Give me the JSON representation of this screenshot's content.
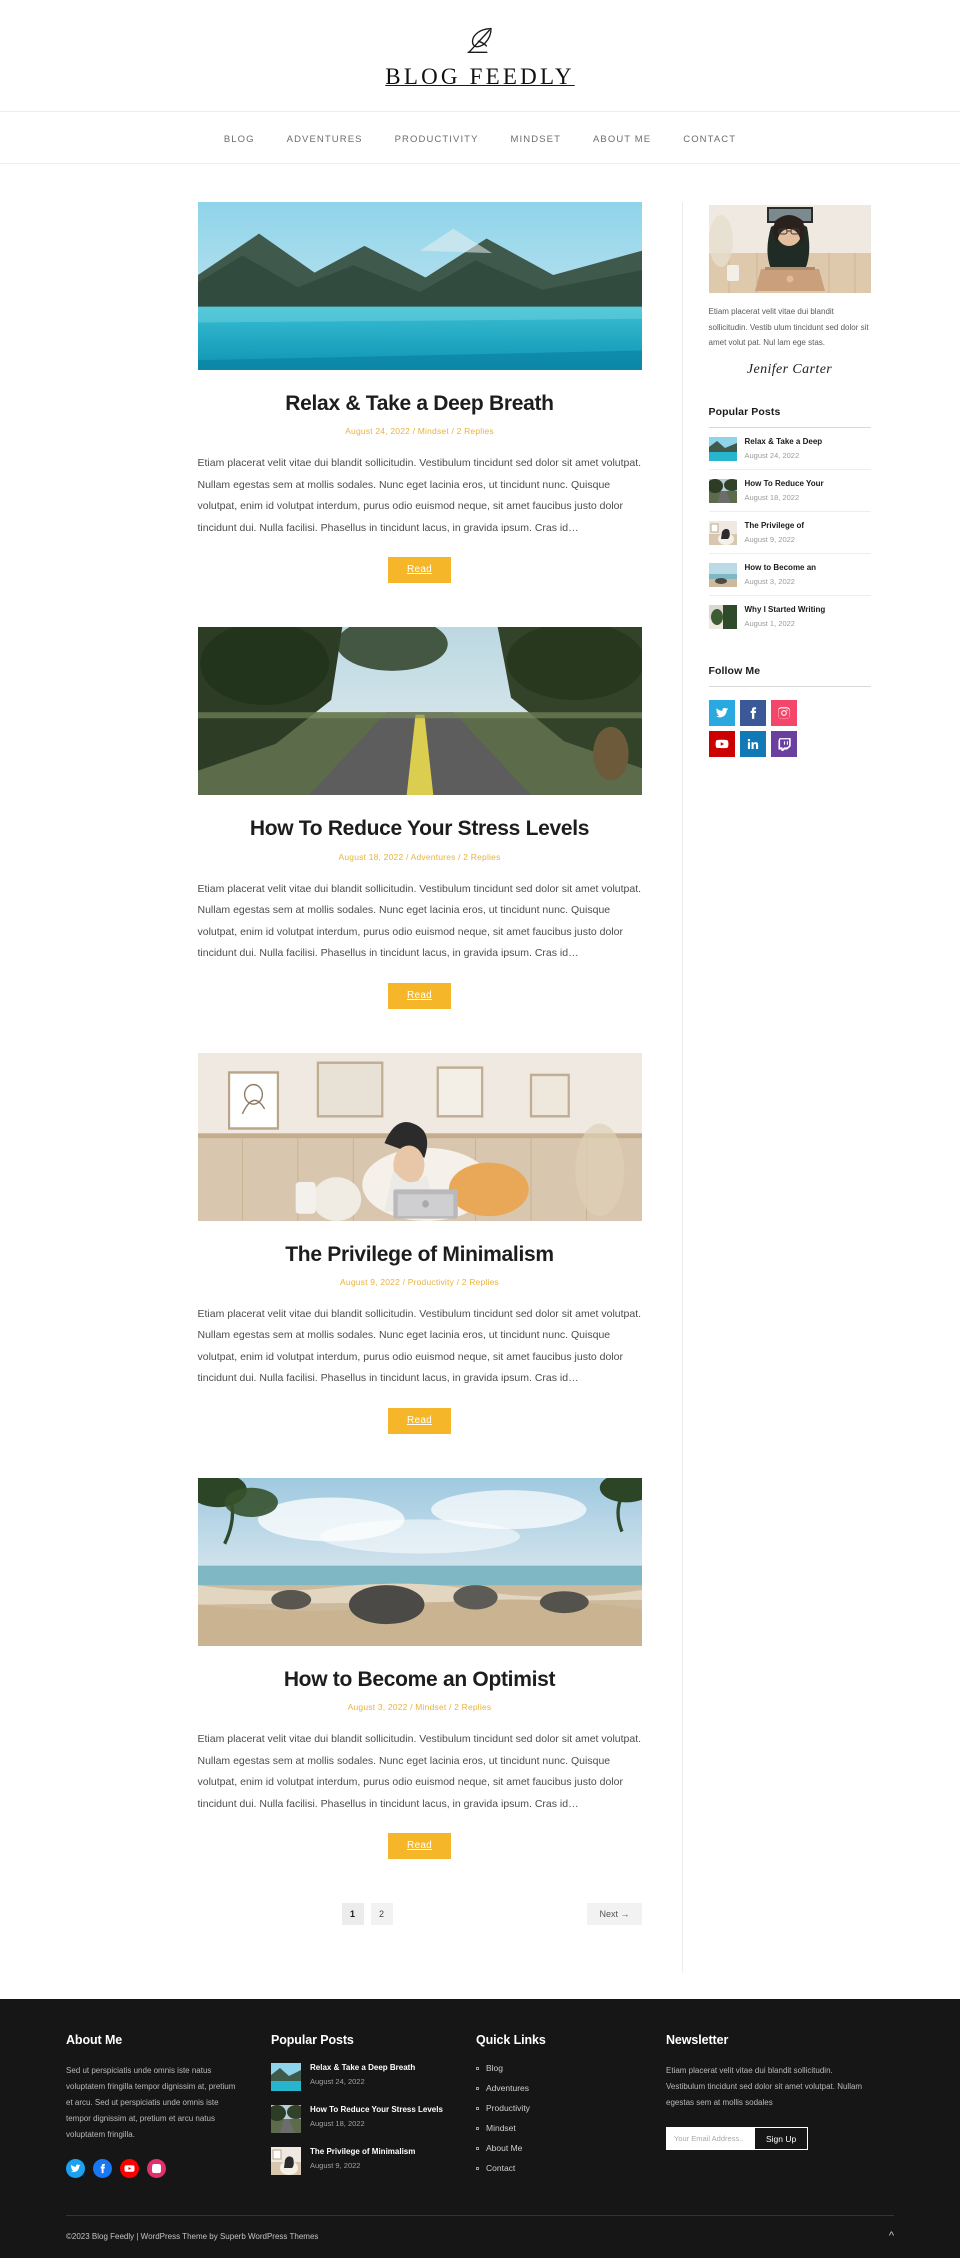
{
  "header": {
    "logo_icon": "feather-quill-icon",
    "logo_text": "BLOG FEEDLY"
  },
  "nav": {
    "items": [
      {
        "label": "BLOG"
      },
      {
        "label": "ADVENTURES"
      },
      {
        "label": "PRODUCTIVITY"
      },
      {
        "label": "MINDSET"
      },
      {
        "label": "ABOUT ME"
      },
      {
        "label": "CONTACT"
      }
    ]
  },
  "posts": [
    {
      "title": "Relax & Take a Deep Breath",
      "meta": "August 24, 2022 / Mindset / 2 Replies",
      "excerpt": "Etiam placerat velit vitae dui blandit sollicitudin. Vestibulum tincidunt sed dolor sit amet volutpat. Nullam egestas sem at mollis sodales. Nunc eget lacinia eros, ut tincidunt nunc. Quisque volutpat, enim id volutpat interdum, purus odio euismod neque, sit amet faucibus justo dolor tincidunt dui. Nulla facilisi. Phasellus in tincidunt lacus, in gravida ipsum. Cras id…",
      "read_label": "Read",
      "image": "lake-mountains-turquoise-water"
    },
    {
      "title": "How To Reduce Your Stress Levels",
      "meta": "August 18, 2022 / Adventures / 2 Replies",
      "excerpt": "Etiam placerat velit vitae dui blandit sollicitudin. Vestibulum tincidunt sed dolor sit amet volutpat. Nullam egestas sem at mollis sodales. Nunc eget lacinia eros, ut tincidunt nunc. Quisque volutpat, enim id volutpat interdum, purus odio euismod neque, sit amet faucibus justo dolor tincidunt dui. Nulla facilisi. Phasellus in tincidunt lacus, in gravida ipsum. Cras id…",
      "read_label": "Read",
      "image": "tree-lined-road-countryside"
    },
    {
      "title": "The Privilege of Minimalism",
      "meta": "August 9, 2022 / Productivity / 2 Replies",
      "excerpt": "Etiam placerat velit vitae dui blandit sollicitudin. Vestibulum tincidunt sed dolor sit amet volutpat. Nullam egestas sem at mollis sodales. Nunc eget lacinia eros, ut tincidunt nunc. Quisque volutpat, enim id volutpat interdum, purus odio euismod neque, sit amet faucibus justo dolor tincidunt dui. Nulla facilisi. Phasellus in tincidunt lacus, in gravida ipsum. Cras id…",
      "read_label": "Read",
      "image": "woman-on-bed-with-laptop-bedroom"
    },
    {
      "title": "How to Become an Optimist",
      "meta": "August 3, 2022 / Mindset / 2 Replies",
      "excerpt": "Etiam placerat velit vitae dui blandit sollicitudin. Vestibulum tincidunt sed dolor sit amet volutpat. Nullam egestas sem at mollis sodales. Nunc eget lacinia eros, ut tincidunt nunc. Quisque volutpat, enim id volutpat interdum, purus odio euismod neque, sit amet faucibus justo dolor tincidunt dui. Nulla facilisi. Phasellus in tincidunt lacus, in gravida ipsum. Cras id…",
      "read_label": "Read",
      "image": "tropical-beach-palm-rocks"
    }
  ],
  "pagination": {
    "pages": [
      "1",
      "2"
    ],
    "current": "1",
    "next_label": "Next →"
  },
  "sidebar": {
    "about": {
      "image": "woman-with-laptop-portrait",
      "text": "Etiam placerat velit vitae dui blandit sollicitudin. Vestib ulum tincidunt sed dolor sit amet volut pat. Nul lam ege stas.",
      "signature": "Jenifer Carter"
    },
    "popular_posts": {
      "title": "Popular Posts",
      "items": [
        {
          "title": "Relax & Take a Deep",
          "date": "August 24, 2022",
          "image": "lake-mountains"
        },
        {
          "title": "How To Reduce Your",
          "date": "August 18, 2022",
          "image": "road-trees"
        },
        {
          "title": "The Privilege of",
          "date": "August 9, 2022",
          "image": "bedroom-woman"
        },
        {
          "title": "How to Become an",
          "date": "August 3, 2022",
          "image": "beach-coast"
        },
        {
          "title": "Why I Started Writing",
          "date": "August 1, 2022",
          "image": "plant-interior"
        }
      ]
    },
    "follow": {
      "title": "Follow Me",
      "items": [
        {
          "name": "twitter",
          "color": "#2AA9E0"
        },
        {
          "name": "facebook",
          "color": "#3B5998"
        },
        {
          "name": "instagram",
          "color": "#F4456A"
        },
        {
          "name": "youtube",
          "color": "#CC0000"
        },
        {
          "name": "linkedin",
          "color": "#1179B5"
        },
        {
          "name": "twitch",
          "color": "#6B3FA0"
        }
      ]
    }
  },
  "footer": {
    "about": {
      "title": "About Me",
      "text": "Sed ut perspiciatis unde omnis iste natus voluptatem fringilla tempor dignissim at, pretium et arcu. Sed ut perspiciatis unde omnis iste tempor dignissim at, pretium et arcu natus voluptatem fringilla.",
      "socials": [
        {
          "name": "twitter",
          "color": "#1DA1F2"
        },
        {
          "name": "facebook",
          "color": "#1877F2"
        },
        {
          "name": "youtube",
          "color": "#FF0000"
        },
        {
          "name": "instagram",
          "color": "#E1306C"
        }
      ]
    },
    "popular": {
      "title": "Popular Posts",
      "items": [
        {
          "title": "Relax & Take a Deep Breath",
          "date": "August 24, 2022",
          "image": "lake-mountains"
        },
        {
          "title": "How To Reduce Your Stress Levels",
          "date": "August 18, 2022",
          "image": "road-trees"
        },
        {
          "title": "The Privilege of Minimalism",
          "date": "August 9, 2022",
          "image": "bedroom-woman"
        }
      ]
    },
    "links": {
      "title": "Quick Links",
      "items": [
        {
          "label": "Blog"
        },
        {
          "label": "Adventures"
        },
        {
          "label": "Productivity"
        },
        {
          "label": "Mindset"
        },
        {
          "label": "About Me"
        },
        {
          "label": "Contact"
        }
      ]
    },
    "newsletter": {
      "title": "Newsletter",
      "text": "Etiam placerat velit vitae dui blandit sollicitudin. Vestibulum tincidunt sed dolor sit amet volutpat. Nullam egestas sem at mollis sodales",
      "placeholder": "Your Email Address..",
      "button_label": "Sign Up"
    },
    "bottom": {
      "copyright": "©2023 Blog Feedly | WordPress Theme by Superb WordPress Themes",
      "to_top_icon": "chevron-up-icon"
    }
  },
  "colors": {
    "accent": "#f5b729",
    "meta": "#e8b33c",
    "footer_bg": "#161616",
    "text": "#1d1d1d"
  }
}
